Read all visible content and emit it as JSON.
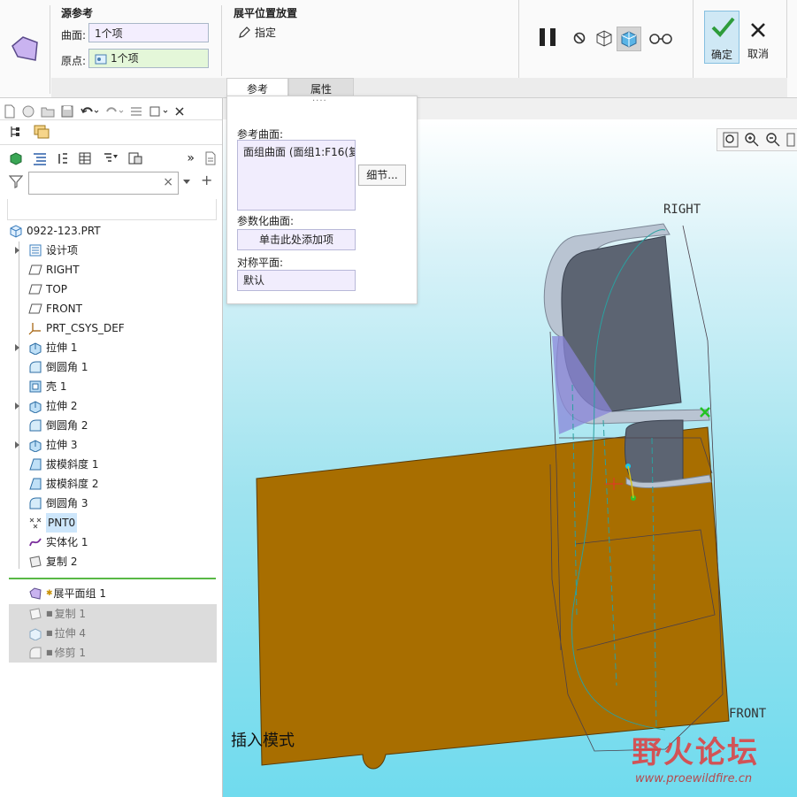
{
  "ribbon": {
    "source_ref_title": "源参考",
    "surface_label": "曲面:",
    "surface_value": "1个项",
    "origin_label": "原点:",
    "origin_value": "1个项",
    "placement_title": "展平位置放置",
    "specify_label": "指定",
    "ok_label": "确定",
    "cancel_label": "取消",
    "tabs": [
      "参考",
      "属性"
    ]
  },
  "popup": {
    "ref_surface_label": "参考曲面:",
    "ref_surface_value": "面组曲面 (面组1:F16(复",
    "detail_button": "细节...",
    "param_surface_label": "参数化曲面:",
    "param_surface_value": "单击此处添加项",
    "sym_plane_label": "对称平面:",
    "sym_plane_value": "默认"
  },
  "tree": {
    "root": "0922-123.PRT",
    "items": [
      "设计项",
      "RIGHT",
      "TOP",
      "FRONT",
      "PRT_CSYS_DEF",
      "拉伸 1",
      "倒圆角 1",
      "壳 1",
      "拉伸 2",
      "倒圆角 2",
      "拉伸 3",
      "拔模斜度 1",
      "拔模斜度 2",
      "倒圆角 3",
      "PNT0",
      "实体化 1",
      "复制 2"
    ],
    "inserted": "展平面组 1",
    "suppressed": [
      "复制 1",
      "拉伸 4",
      "修剪 1"
    ]
  },
  "graphics": {
    "mode_text": "插入模式",
    "datum_right": "RIGHT",
    "datum_front": "FRONT",
    "watermark_brand": "野火论坛",
    "watermark_url": "www.proewildfire.cn"
  },
  "colors": {
    "part_body": "#a86e00",
    "accent_blue": "#0a64c8",
    "confirm_bg": "#cfe8f5"
  }
}
